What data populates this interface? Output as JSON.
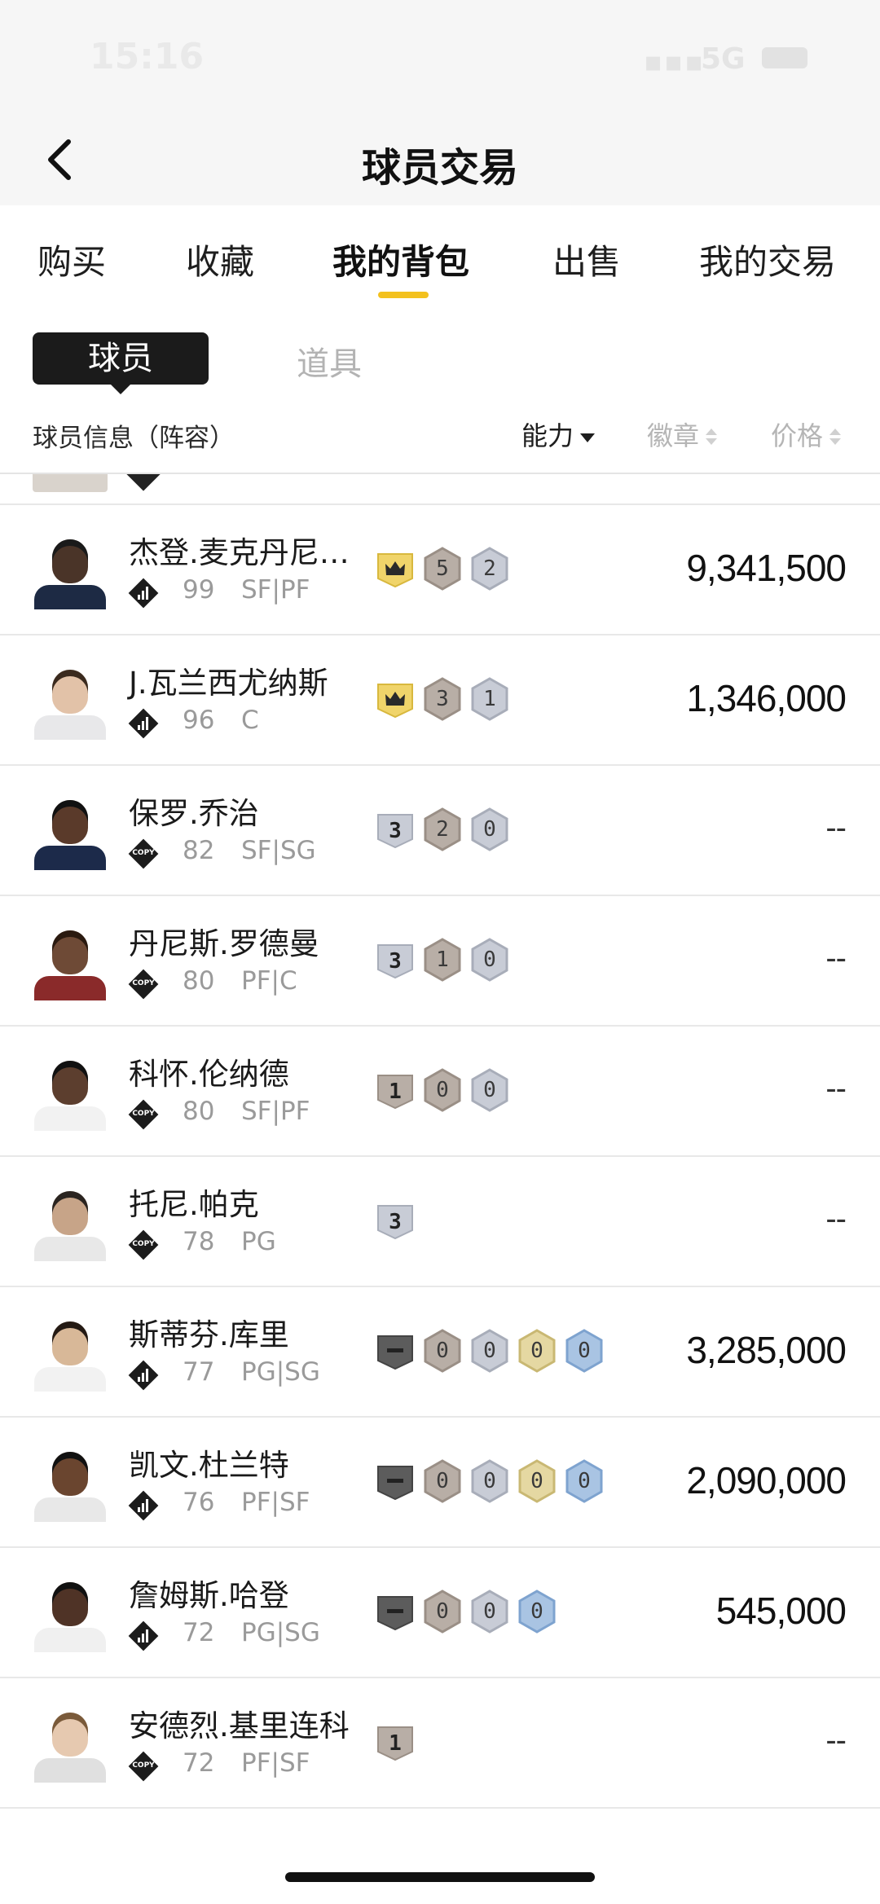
{
  "status_bar": {
    "time": "15:16",
    "signal": "▪▪▪",
    "network": "5G"
  },
  "nav": {
    "title": "球员交易"
  },
  "tabs": [
    {
      "label": "购买",
      "active": false
    },
    {
      "label": "收藏",
      "active": false
    },
    {
      "label": "我的背包",
      "active": true
    },
    {
      "label": "出售",
      "active": false
    },
    {
      "label": "我的交易",
      "active": false
    }
  ],
  "sub_tabs": {
    "player": "球员",
    "items": "道具"
  },
  "columns": {
    "info": "球员信息（阵容）",
    "ability": "能力",
    "badge": "徽章",
    "price": "价格"
  },
  "colors": {
    "accent": "#f3c11e",
    "crown_gold": "#f0d46a",
    "badge_bronze": "#b8aea6",
    "badge_silver": "#c8ccd6",
    "badge_gold": "#e5d8a2",
    "badge_blue": "#a9c4e3",
    "badge_dark": "#5c5c5c"
  },
  "players": [
    {
      "name": "杰登.麦克丹尼…",
      "rating": "99",
      "position": "SF|PF",
      "card": "bars",
      "price": "9,341,500",
      "badges": [
        {
          "type": "crown",
          "value": ""
        },
        {
          "type": "bronze",
          "value": "5"
        },
        {
          "type": "silver",
          "value": "2"
        }
      ]
    },
    {
      "name": "J.瓦兰西尤纳斯",
      "rating": "96",
      "position": "C",
      "card": "bars",
      "price": "1,346,000",
      "badges": [
        {
          "type": "crown",
          "value": ""
        },
        {
          "type": "bronze",
          "value": "3"
        },
        {
          "type": "silver",
          "value": "1"
        }
      ]
    },
    {
      "name": "保罗.乔治",
      "rating": "82",
      "position": "SF|SG",
      "card": "copy",
      "price": "--",
      "badges": [
        {
          "type": "level-silver",
          "value": "3"
        },
        {
          "type": "bronze",
          "value": "2"
        },
        {
          "type": "silver",
          "value": "0"
        }
      ]
    },
    {
      "name": "丹尼斯.罗德曼",
      "rating": "80",
      "position": "PF|C",
      "card": "copy",
      "price": "--",
      "badges": [
        {
          "type": "level-silver",
          "value": "3"
        },
        {
          "type": "bronze",
          "value": "1"
        },
        {
          "type": "silver",
          "value": "0"
        }
      ]
    },
    {
      "name": "科怀.伦纳德",
      "rating": "80",
      "position": "SF|PF",
      "card": "copy",
      "price": "--",
      "badges": [
        {
          "type": "level-bronze",
          "value": "1"
        },
        {
          "type": "bronze",
          "value": "0"
        },
        {
          "type": "silver",
          "value": "0"
        }
      ]
    },
    {
      "name": "托尼.帕克",
      "rating": "78",
      "position": "PG",
      "card": "copy",
      "price": "--",
      "badges": [
        {
          "type": "level-silver",
          "value": "3"
        }
      ]
    },
    {
      "name": "斯蒂芬.库里",
      "rating": "77",
      "position": "PG|SG",
      "card": "bars",
      "price": "3,285,000",
      "badges": [
        {
          "type": "level-dark",
          "value": ""
        },
        {
          "type": "bronze",
          "value": "0"
        },
        {
          "type": "silver",
          "value": "0"
        },
        {
          "type": "gold",
          "value": "0"
        },
        {
          "type": "blue",
          "value": "0"
        }
      ]
    },
    {
      "name": "凯文.杜兰特",
      "rating": "76",
      "position": "PF|SF",
      "card": "bars",
      "price": "2,090,000",
      "badges": [
        {
          "type": "level-dark",
          "value": ""
        },
        {
          "type": "bronze",
          "value": "0"
        },
        {
          "type": "silver",
          "value": "0"
        },
        {
          "type": "gold",
          "value": "0"
        },
        {
          "type": "blue",
          "value": "0"
        }
      ]
    },
    {
      "name": "詹姆斯.哈登",
      "rating": "72",
      "position": "PG|SG",
      "card": "bars",
      "price": "545,000",
      "badges": [
        {
          "type": "level-dark",
          "value": ""
        },
        {
          "type": "bronze",
          "value": "0"
        },
        {
          "type": "silver",
          "value": "0"
        },
        {
          "type": "blue",
          "value": "0"
        }
      ]
    },
    {
      "name": "安德烈.基里连科",
      "rating": "72",
      "position": "PF|SF",
      "card": "copy",
      "price": "--",
      "badges": [
        {
          "type": "level-bronze",
          "value": "1"
        }
      ]
    }
  ]
}
